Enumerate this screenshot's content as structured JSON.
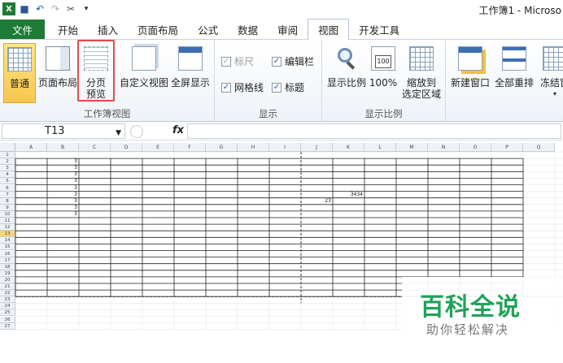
{
  "window": {
    "title": "工作簿1 - Microso"
  },
  "qat": {
    "undo_icon": "undo-icon",
    "redo_icon": "redo-icon"
  },
  "tabs": [
    "文件",
    "开始",
    "插入",
    "页面布局",
    "公式",
    "数据",
    "审阅",
    "视图",
    "开发工具"
  ],
  "ribbon": {
    "workbook_views": {
      "label": "工作簿视图",
      "normal": "普通",
      "page_layout": "页面布局",
      "page_break_line1": "分页",
      "page_break_line2": "预览",
      "custom_views": "自定义视图",
      "full_screen": "全屏显示"
    },
    "show": {
      "label": "显示",
      "ruler": "标尺",
      "formula_bar": "编辑栏",
      "gridlines": "网格线",
      "headings": "标题"
    },
    "zoom": {
      "label": "显示比例",
      "zoom": "显示比例",
      "hundred": "100%",
      "zoom_sel_line1": "缩放到",
      "zoom_sel_line2": "选定区域",
      "hundred_icon_text": "100"
    },
    "window": {
      "new_window": "新建窗口",
      "arrange_all": "全部重排",
      "freeze": "冻结窗"
    }
  },
  "formula_bar": {
    "name_box": "T13",
    "fx": "fx"
  },
  "sheet": {
    "columns": [
      "A",
      "B",
      "C",
      "D",
      "E",
      "F",
      "G",
      "H",
      "I",
      "J",
      "K",
      "L",
      "M",
      "N",
      "O",
      "P",
      "Q"
    ],
    "rows": [
      "1",
      "2",
      "3",
      "4",
      "5",
      "6",
      "7",
      "8",
      "9",
      "10",
      "11",
      "12",
      "13",
      "14",
      "15",
      "16",
      "17",
      "18",
      "19",
      "20",
      "21",
      "22",
      "23",
      "24",
      "25",
      "26",
      "27"
    ],
    "selected_row": "13",
    "col_b_values": [
      "3",
      "3",
      "3",
      "3",
      "3",
      "3",
      "3",
      "3",
      "3"
    ],
    "j8": "23",
    "k7": "3434"
  },
  "watermark": {
    "line1": "百科全说",
    "line2": "助你轻松解决"
  }
}
